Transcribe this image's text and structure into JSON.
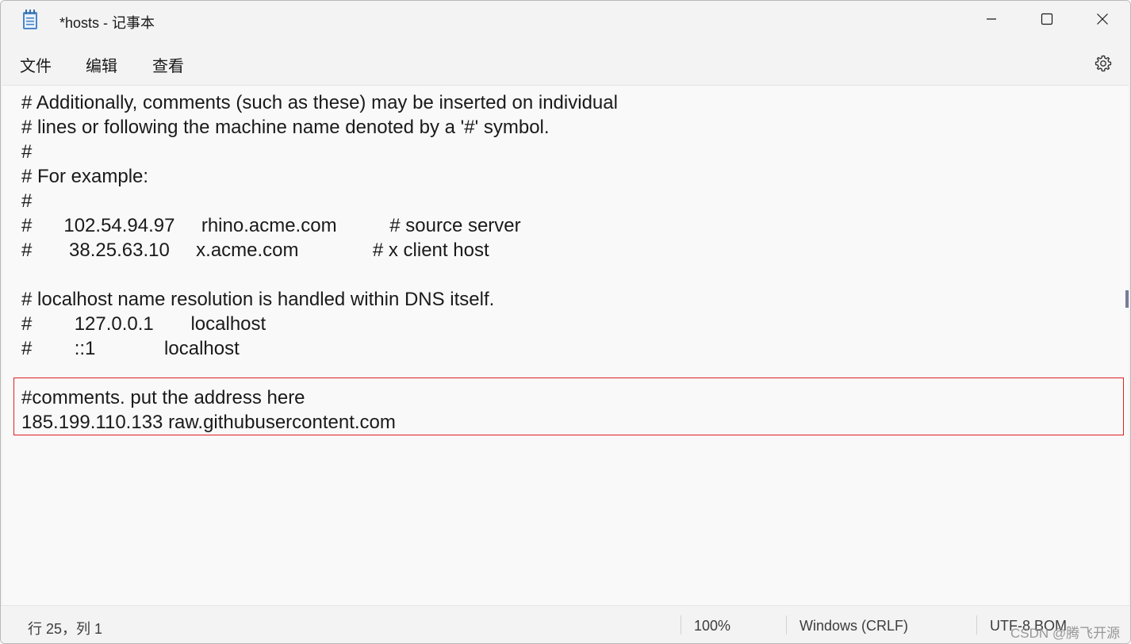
{
  "window": {
    "title": "*hosts - 记事本"
  },
  "menu": {
    "file": "文件",
    "edit": "编辑",
    "view": "查看"
  },
  "icons": {
    "app": "notepad-icon",
    "minimize": "minimize-icon",
    "maximize": "maximize-icon",
    "close": "close-icon",
    "settings": "gear-icon"
  },
  "editor": {
    "lines": [
      "# Additionally, comments (such as these) may be inserted on individual",
      "# lines or following the machine name denoted by a '#' symbol.",
      "#",
      "# For example:",
      "#",
      "#      102.54.94.97     rhino.acme.com          # source server",
      "#       38.25.63.10     x.acme.com              # x client host",
      "",
      "# localhost name resolution is handled within DNS itself.",
      "#        127.0.0.1       localhost",
      "#        ::1             localhost",
      "",
      "#comments. put the address here",
      "185.199.110.133 raw.githubusercontent.com"
    ]
  },
  "status": {
    "position": "行 25，列 1",
    "zoom": "100%",
    "line_ending": "Windows (CRLF)",
    "encoding": "UTF-8 BOM"
  },
  "watermark": "CSDN @腾飞开源",
  "colors": {
    "highlight_border": "#e02020",
    "editor_bg": "#f9f9f9",
    "chrome_bg": "#f3f3f3"
  }
}
